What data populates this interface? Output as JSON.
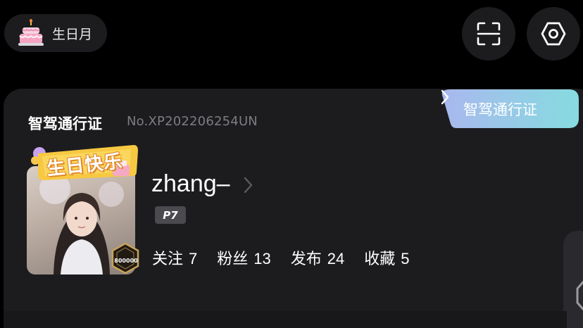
{
  "top_bar": {
    "birthday_label": "生日月",
    "cake_icon": "birthday-cake-icon",
    "scan_icon": "scan-icon",
    "settings_icon": "hexagon-settings-icon"
  },
  "card": {
    "title": "智驾通行证",
    "number": "No.XP202206254UN",
    "pass_tag_label": "智驾通行证",
    "avatar_banner": "生日快乐",
    "avatar_badge": "800000",
    "username": "zhang–",
    "level": "P7",
    "stats": [
      {
        "label": "关注",
        "value": "7"
      },
      {
        "label": "粉丝",
        "value": "13"
      },
      {
        "label": "发布",
        "value": "24"
      },
      {
        "label": "收藏",
        "value": "5"
      }
    ]
  },
  "colors": {
    "background": "#000000",
    "card": "#1c1c1f",
    "pass_tag_gradient_start": "#a9b8ee",
    "pass_tag_gradient_end": "#86dbe0",
    "secondary_text": "#7c7c82"
  }
}
